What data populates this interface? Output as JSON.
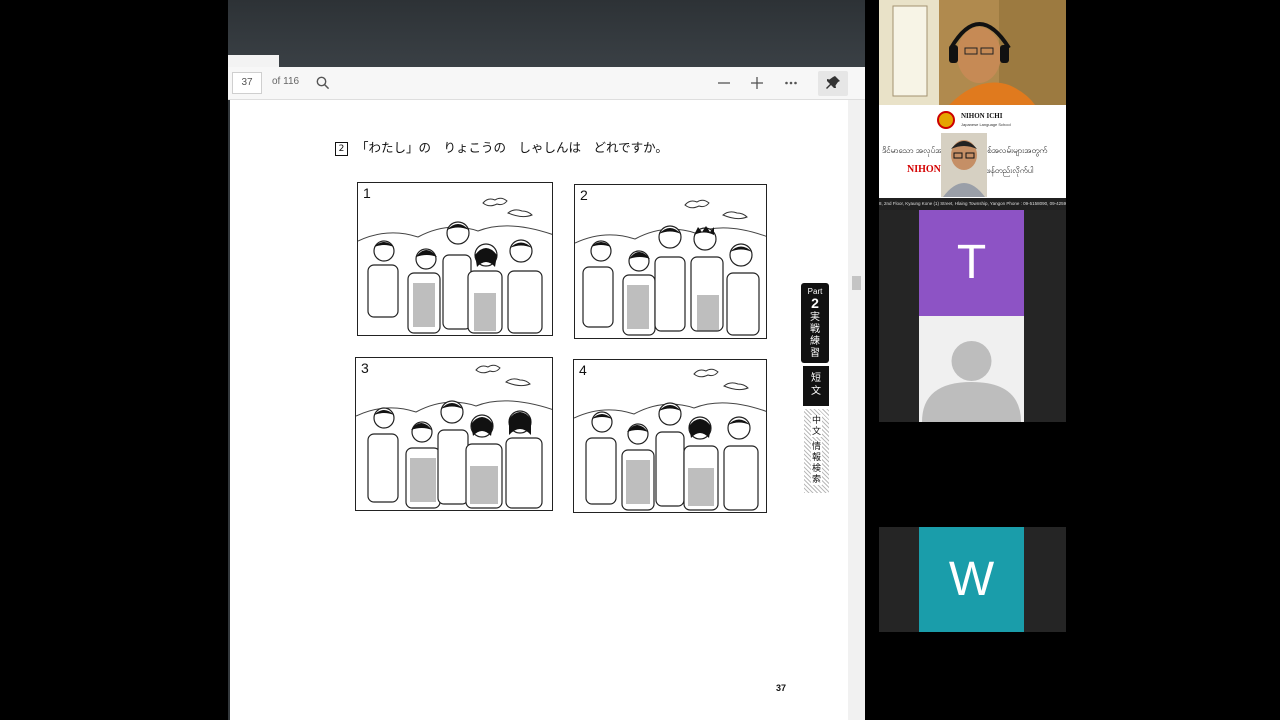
{
  "viewer": {
    "page_current": "37",
    "page_total_label": "of 116",
    "icons": [
      "search-icon",
      "zoom-out-icon",
      "zoom-in-icon",
      "more-icon",
      "pin-icon"
    ]
  },
  "document": {
    "question_number": "2",
    "question_text": "「わたし」の　りょこうの　しゃしんは　どれですか。",
    "pictures": [
      {
        "number": "1"
      },
      {
        "number": "2"
      },
      {
        "number": "3"
      },
      {
        "number": "4"
      }
    ],
    "side_tab": {
      "part_label": "Part",
      "part_number": "2",
      "section_title": "実戦練習",
      "short_text": "短文",
      "mid_text": "中文",
      "search_text": "情報検索"
    },
    "page_number": "37"
  },
  "participants": {
    "banner": {
      "school_name": "NIHON ICHI",
      "school_subtitle": "Japanese Language School",
      "tagline": "ဒိင်မာသော အလုပ်အကိုင်မျိုးဆက်သစ်အလမ်းများအတွက်",
      "brand_red": "NIHON ICHI",
      "tagline_2": "ဖန်တည်းလိုက်ပါ",
      "address": "8, 2nd Floor, Kyaung Kone (1) Street, Hlaing Township, Yangon Phone : 09-5158090, 09-425950"
    },
    "t_letter": "T",
    "w_letter": "W",
    "colors": {
      "t_tile": "#8d53c5",
      "w_tile": "#1a9daa",
      "brand_red": "#d40000"
    }
  }
}
